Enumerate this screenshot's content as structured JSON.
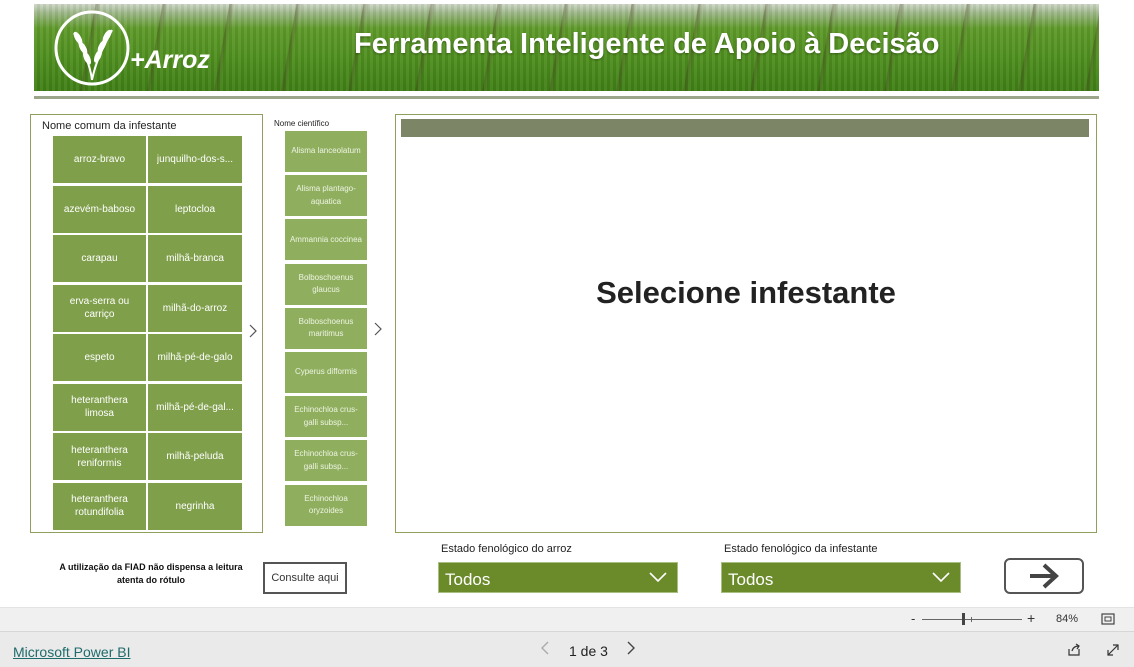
{
  "header": {
    "logo_text": "+Arroz",
    "title": "Ferramenta Inteligente de Apoio à Decisão"
  },
  "common_names": {
    "title": "Nome comum da infestante",
    "items": [
      "arroz-bravo",
      "junquilho-dos-s...",
      "azevém-baboso",
      "leptocloa",
      "carapau",
      "milhã-branca",
      "erva-serra ou carriço",
      "milhã-do-arroz",
      "espeto",
      "milhã-pé-de-galo",
      "heteranthera limosa",
      "milhã-pé-de-gal...",
      "heteranthera reniformis",
      "milhã-peluda",
      "heteranthera rotundifolia",
      "negrinha"
    ]
  },
  "scientific_names": {
    "title": "Nome científico",
    "items": [
      "Alisma lanceolatum",
      "Alisma plantago-aquatica",
      "Ammannia coccinea",
      "Bolboschoenus glaucus",
      "Bolboschoenus maritimus",
      "Cyperus difformis",
      "Echinochloa crus-galli subsp...",
      "Echinochloa crus-galli subsp...",
      "Echinochloa oryzoides"
    ]
  },
  "main": {
    "message": "Selecione infestante"
  },
  "footer": {
    "disclaimer": "A utilização da FIAD não dispensa a leitura atenta do rótulo",
    "consult_label": "Consulte aqui",
    "rice_stage_label": "Estado fenológico do arroz",
    "rice_stage_value": "Todos",
    "weed_stage_label": "Estado fenológico da infestante",
    "weed_stage_value": "Todos"
  },
  "zoom": {
    "minus": "-",
    "plus": "+",
    "value": "84%"
  },
  "bottom_bar": {
    "brand_link": "Microsoft Power BI",
    "page_indicator": "1 de 3"
  },
  "colors": {
    "tile": "#7f9f4b",
    "sci_tile": "#8faf5e",
    "select": "#6b8a2a",
    "border": "#8fa05c"
  }
}
